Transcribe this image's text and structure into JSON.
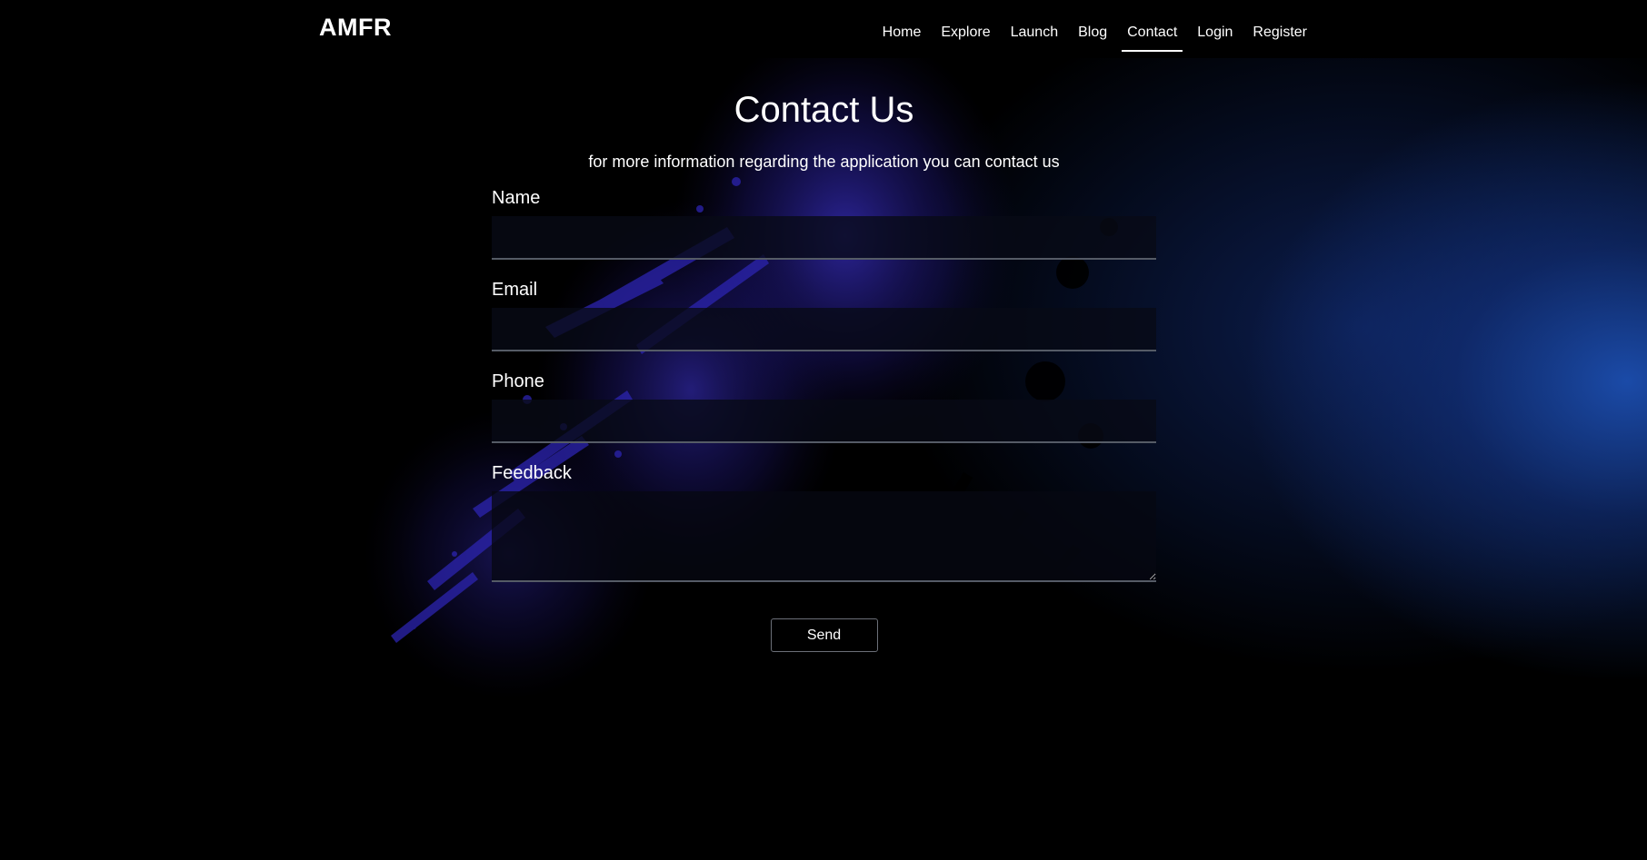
{
  "navbar": {
    "brand": "AMFR",
    "items": [
      {
        "label": "Home",
        "active": false
      },
      {
        "label": "Explore",
        "active": false
      },
      {
        "label": "Launch",
        "active": false
      },
      {
        "label": "Blog",
        "active": false
      },
      {
        "label": "Contact",
        "active": true
      },
      {
        "label": "Login",
        "active": false
      },
      {
        "label": "Register",
        "active": false
      }
    ]
  },
  "main": {
    "title": "Contact Us",
    "subtitle": "for more information regarding the application you can contact us",
    "form": {
      "name_label": "Name",
      "name_value": "",
      "email_label": "Email",
      "email_value": "",
      "phone_label": "Phone",
      "phone_value": "",
      "feedback_label": "Feedback",
      "feedback_value": "",
      "send_label": "Send"
    }
  },
  "colors": {
    "background": "#000000",
    "accent_blue": "#1c4eaf",
    "splash_purple": "#2b23a8",
    "text": "#ffffff"
  }
}
